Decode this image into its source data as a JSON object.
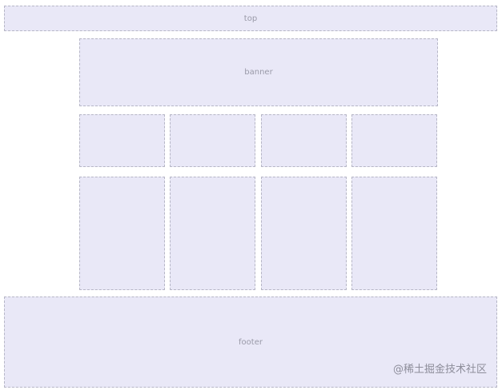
{
  "labels": {
    "top": "top",
    "banner": "banner",
    "footer": "footer"
  },
  "watermark": "@稀土掘金技术社区",
  "colors": {
    "box_fill": "#e9e8f7",
    "box_border": "#b6b6c6",
    "text": "#9a9aa8"
  }
}
